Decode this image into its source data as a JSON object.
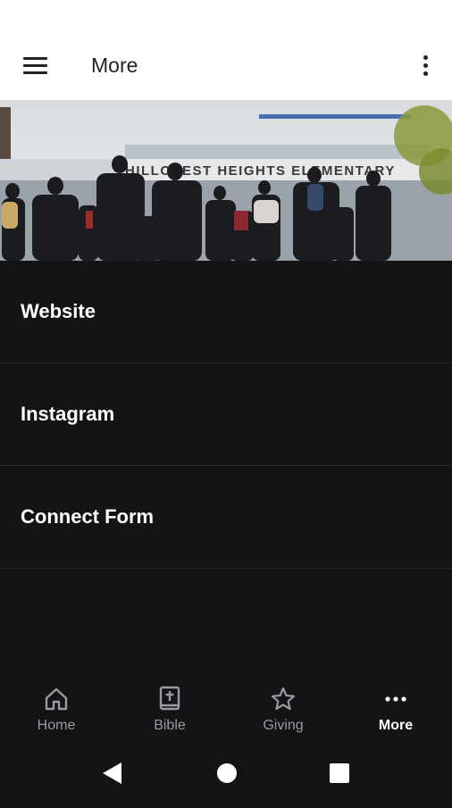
{
  "app": {
    "title": "More",
    "menu_icon": "hamburger-menu-icon",
    "overflow_icon": "more-vert-icon"
  },
  "hero": {
    "sign_text": "HILLCREST HEIGHTS ELEMENTARY"
  },
  "list": {
    "items": [
      {
        "label": "Website"
      },
      {
        "label": "Instagram"
      },
      {
        "label": "Connect Form"
      }
    ]
  },
  "bottom_nav": {
    "items": [
      {
        "label": "Home",
        "icon": "home-icon"
      },
      {
        "label": "Bible",
        "icon": "bible-icon"
      },
      {
        "label": "Giving",
        "icon": "star-icon"
      },
      {
        "label": "More",
        "icon": "more-horiz-icon",
        "active": true
      }
    ]
  },
  "colors": {
    "background": "#141416",
    "appbar": "#ffffff",
    "text_primary": "#ffffff",
    "nav_inactive": "#9b9b9f"
  }
}
